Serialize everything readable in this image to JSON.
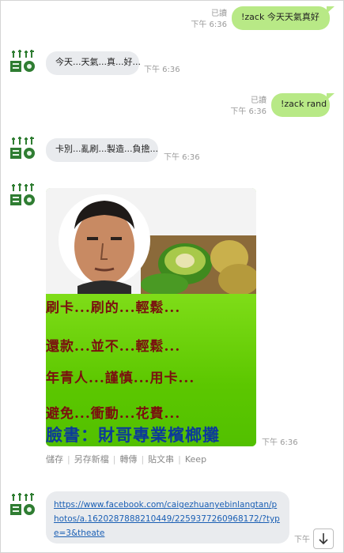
{
  "messages": [
    {
      "side": "out",
      "text": "!zack 今天天氣真好",
      "read": "已讀",
      "time": "下午 6:36"
    },
    {
      "side": "in",
      "text": "今天...天氣...真...好...",
      "time": "下午 6:36"
    },
    {
      "side": "out",
      "text": "!zack rand",
      "read": "已讀",
      "time": "下午 6:36"
    },
    {
      "side": "in",
      "text": "卡別...亂刷...製造...負擔...",
      "time": "下午 6:36"
    },
    {
      "side": "in",
      "type": "image",
      "time": "下午 6:36",
      "image_text": [
        "刷卡...刷的...輕鬆...",
        "還款...並不...輕鬆...",
        "年青人...謹慎...用卡...",
        "避免...衝動...花費..."
      ],
      "image_signature": "臉書：財哥專業檳榔攤"
    },
    {
      "side": "in",
      "type": "link",
      "time": "下午",
      "url": "https://www.facebook.com/caigezhuanyebinlangtan/photos/a.1620287888210449/2259377260968172/?type=3&theate"
    }
  ],
  "image_actions": [
    "儲存",
    "另存新檔",
    "轉傳",
    "貼文串",
    "Keep"
  ],
  "avatar": {
    "icon": "bot-avatar-icon",
    "color": "#2f7d32"
  }
}
